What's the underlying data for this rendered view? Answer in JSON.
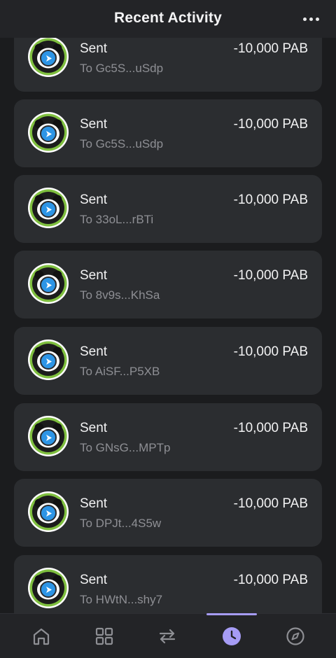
{
  "header": {
    "title": "Recent Activity"
  },
  "transactions": [
    {
      "type": "Sent",
      "recipient": "To Gc5S...uSdp",
      "amount": "-10,000 PAB"
    },
    {
      "type": "Sent",
      "recipient": "To Gc5S...uSdp",
      "amount": "-10,000 PAB"
    },
    {
      "type": "Sent",
      "recipient": "To 33oL...rBTi",
      "amount": "-10,000 PAB"
    },
    {
      "type": "Sent",
      "recipient": "To 8v9s...KhSa",
      "amount": "-10,000 PAB"
    },
    {
      "type": "Sent",
      "recipient": "To AiSF...P5XB",
      "amount": "-10,000 PAB"
    },
    {
      "type": "Sent",
      "recipient": "To GNsG...MPTp",
      "amount": "-10,000 PAB"
    },
    {
      "type": "Sent",
      "recipient": "To DPJt...4S5w",
      "amount": "-10,000 PAB"
    },
    {
      "type": "Sent",
      "recipient": "To HWtN...shy7",
      "amount": "-10,000 PAB"
    }
  ],
  "token_icon": "panda-token-icon",
  "badge_icon": "send-arrow-icon",
  "nav": {
    "items": [
      {
        "icon": "home-icon",
        "active": false
      },
      {
        "icon": "grid-icon",
        "active": false
      },
      {
        "icon": "swap-icon",
        "active": false
      },
      {
        "icon": "clock-icon",
        "active": true
      },
      {
        "icon": "compass-icon",
        "active": false
      }
    ]
  },
  "colors": {
    "background": "#1b1c1e",
    "card": "#2b2d30",
    "accent": "#a69cf5",
    "badge": "#2d95e6",
    "muted_text": "#8e8f94"
  }
}
